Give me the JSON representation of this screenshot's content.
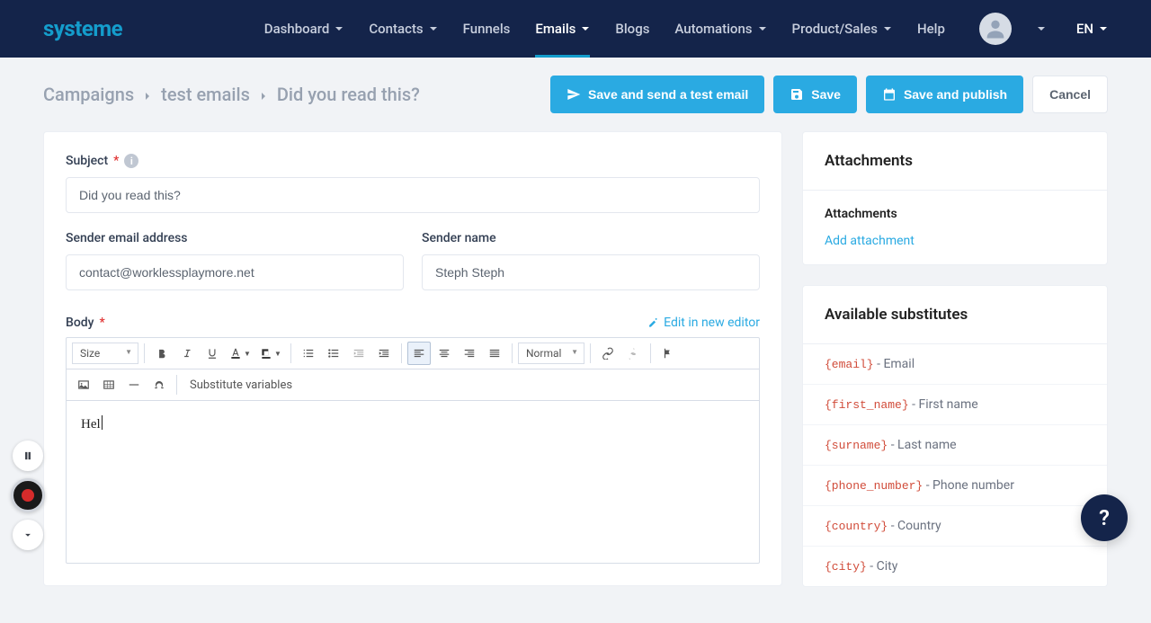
{
  "brand": "systeme",
  "nav": {
    "items": [
      {
        "label": "Dashboard",
        "dropdown": true
      },
      {
        "label": "Contacts",
        "dropdown": true
      },
      {
        "label": "Funnels",
        "dropdown": false
      },
      {
        "label": "Emails",
        "dropdown": true,
        "active": true
      },
      {
        "label": "Blogs",
        "dropdown": false
      },
      {
        "label": "Automations",
        "dropdown": true
      },
      {
        "label": "Product/Sales",
        "dropdown": true
      },
      {
        "label": "Help",
        "dropdown": false
      }
    ],
    "lang": "EN"
  },
  "breadcrumb": [
    "Campaigns",
    "test emails",
    "Did you read this?"
  ],
  "actions": {
    "test": "Save and send a test email",
    "save": "Save",
    "publish": "Save and publish",
    "cancel": "Cancel"
  },
  "form": {
    "subject_label": "Subject",
    "subject_value": "Did you read this?",
    "sender_email_label": "Sender email address",
    "sender_email_value": "contact@worklessplaymore.net",
    "sender_name_label": "Sender name",
    "sender_name_value": "Steph Steph",
    "body_label": "Body",
    "edit_new": "Edit in new editor",
    "body_content": "Hel"
  },
  "toolbar": {
    "size": "Size",
    "format": "Normal",
    "sub_vars": "Substitute variables"
  },
  "attachments": {
    "title": "Attachments",
    "subtitle": "Attachments",
    "add": "Add attachment"
  },
  "substitutes": {
    "title": "Available substitutes",
    "items": [
      {
        "code": "{email}",
        "desc": "Email"
      },
      {
        "code": "{first_name}",
        "desc": "First name"
      },
      {
        "code": "{surname}",
        "desc": "Last name"
      },
      {
        "code": "{phone_number}",
        "desc": "Phone number"
      },
      {
        "code": "{country}",
        "desc": "Country"
      },
      {
        "code": "{city}",
        "desc": "City"
      }
    ]
  }
}
